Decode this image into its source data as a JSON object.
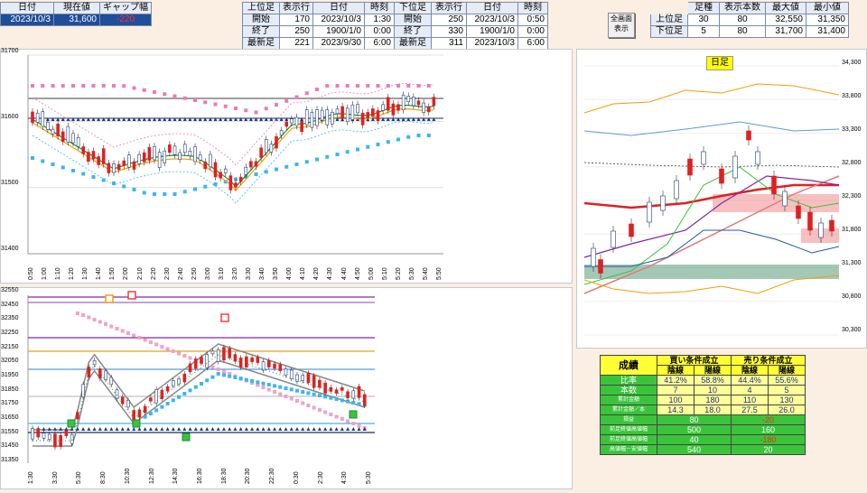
{
  "header1": {
    "cols": [
      "日付",
      "現在値",
      "ギャップ幅"
    ],
    "row": [
      "2023/10/3",
      "31,600",
      "-220"
    ]
  },
  "header2": {
    "cols": [
      "上位足",
      "表示行",
      "日付",
      "時刻",
      "下位足",
      "表示行",
      "日付",
      "時刻"
    ],
    "rows": [
      [
        "開始",
        "170",
        "2023/10/3",
        "1:30",
        "開始",
        "250",
        "2023/10/3",
        "0:50"
      ],
      [
        "終了",
        "250",
        "1900/1/0",
        "0:00",
        "終了",
        "330",
        "1900/1/0",
        "0:00"
      ],
      [
        "最新足",
        "221",
        "2023/9/30",
        "6:00",
        "最新足",
        "311",
        "2023/10/3",
        "6:00"
      ]
    ]
  },
  "fullscreen_button": {
    "line1": "全画面",
    "line2": "表示"
  },
  "header3": {
    "cols": [
      "足種",
      "表示本数",
      "最大値",
      "最小値"
    ],
    "rows": [
      [
        "上位足",
        "30",
        "80",
        "32,550",
        "31,350"
      ],
      [
        "下位足",
        "5",
        "80",
        "31,700",
        "31,400"
      ]
    ]
  },
  "chart1": {
    "yticks": [
      "31700",
      "31600",
      "31500",
      "31400"
    ],
    "xticks": [
      "0:50",
      "1:00",
      "1:10",
      "1:20",
      "1:30",
      "1:40",
      "1:50",
      "2:00",
      "2:10",
      "2:20",
      "2:30",
      "2:40",
      "2:50",
      "3:00",
      "3:10",
      "3:20",
      "3:30",
      "3:40",
      "3:50",
      "4:00",
      "4:10",
      "4:20",
      "4:30",
      "4:40",
      "4:50",
      "5:00",
      "5:10",
      "5:20",
      "5:30",
      "5:40",
      "5:50"
    ]
  },
  "chart2": {
    "yticks": [
      "32550",
      "32450",
      "32350",
      "32250",
      "32150",
      "32050",
      "31950",
      "31850",
      "31750",
      "31650",
      "31550",
      "31450",
      "31350"
    ],
    "xticks": [
      "1:30",
      "3:30",
      "5:30",
      "8:30",
      "10:30",
      "12:30",
      "14:30",
      "16:30",
      "18:30",
      "20:30",
      "22:30",
      "0:30",
      "2:30",
      "4:30",
      "5:30"
    ]
  },
  "chart3": {
    "title": "日足",
    "yticks": [
      "34,300",
      "33,800",
      "33,300",
      "32,800",
      "32,300",
      "31,800",
      "31,300",
      "30,800",
      "30,300"
    ]
  },
  "results": {
    "title": "成績",
    "buy": "買い条件成立",
    "sell": "売り条件成立",
    "subcols": [
      "陰線",
      "陽線",
      "陰線",
      "陽線"
    ],
    "rows": [
      {
        "label": "比率",
        "values": [
          "41.2%",
          "58.8%",
          "44.4%",
          "55.6%"
        ]
      },
      {
        "label": "本数",
        "values": [
          "7",
          "10",
          "4",
          "5"
        ]
      },
      {
        "label": "累計金額",
        "values": [
          "100",
          "180",
          "110",
          "130"
        ]
      },
      {
        "label": "累計金額／本",
        "values": [
          "14.3",
          "18.0",
          "27.5",
          "26.0"
        ]
      }
    ],
    "rows2": [
      {
        "label": "損益",
        "buy": "80",
        "sell": "-20"
      },
      {
        "label": "前足終値高値幅",
        "buy": "500",
        "sell": "160"
      },
      {
        "label": "前足終値高値幅",
        "buy": "40",
        "sell": "-180"
      },
      {
        "label": "高値幅－安値幅",
        "buy": "540",
        "sell": "20"
      }
    ]
  }
}
